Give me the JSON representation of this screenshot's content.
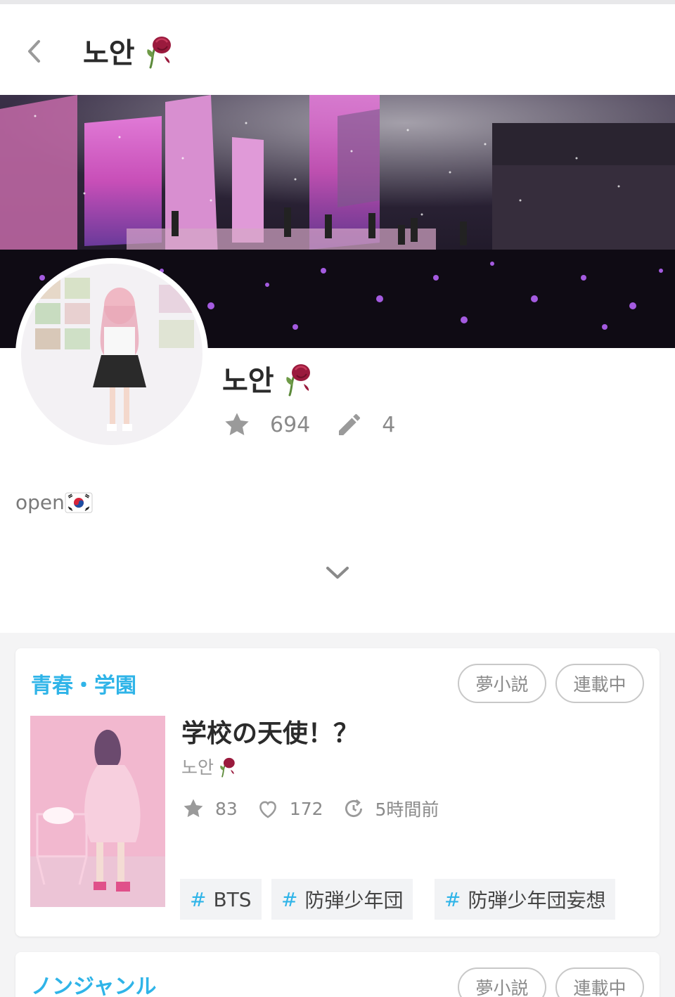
{
  "header": {
    "title": "노안",
    "back_icon": "chevron-left-icon",
    "title_icon": "wilted-rose-icon"
  },
  "cover": {
    "image": "concert-stage-photo"
  },
  "profile": {
    "name": "노안",
    "name_icon": "wilted-rose-icon",
    "stars": "694",
    "posts": "4",
    "bio": "open",
    "bio_icon": "korea-flag-icon",
    "expand_icon": "chevron-down-icon"
  },
  "works": [
    {
      "genre": "青春・学園",
      "badges": [
        "夢小説",
        "連載中"
      ],
      "title": "学校の天使！？",
      "author": "노안",
      "stars": "83",
      "likes": "172",
      "updated": "5時間前",
      "tags": [
        "BTS",
        "防弾少年団",
        "防弾少年団妄想"
      ]
    },
    {
      "genre": "ノンジャンル",
      "badges": [
        "夢小説",
        "連載中"
      ]
    }
  ],
  "colors": {
    "accent": "#2fb4e8",
    "text": "#2b2b2b",
    "muted": "#8a8a8a",
    "rose": "#8e1535"
  }
}
